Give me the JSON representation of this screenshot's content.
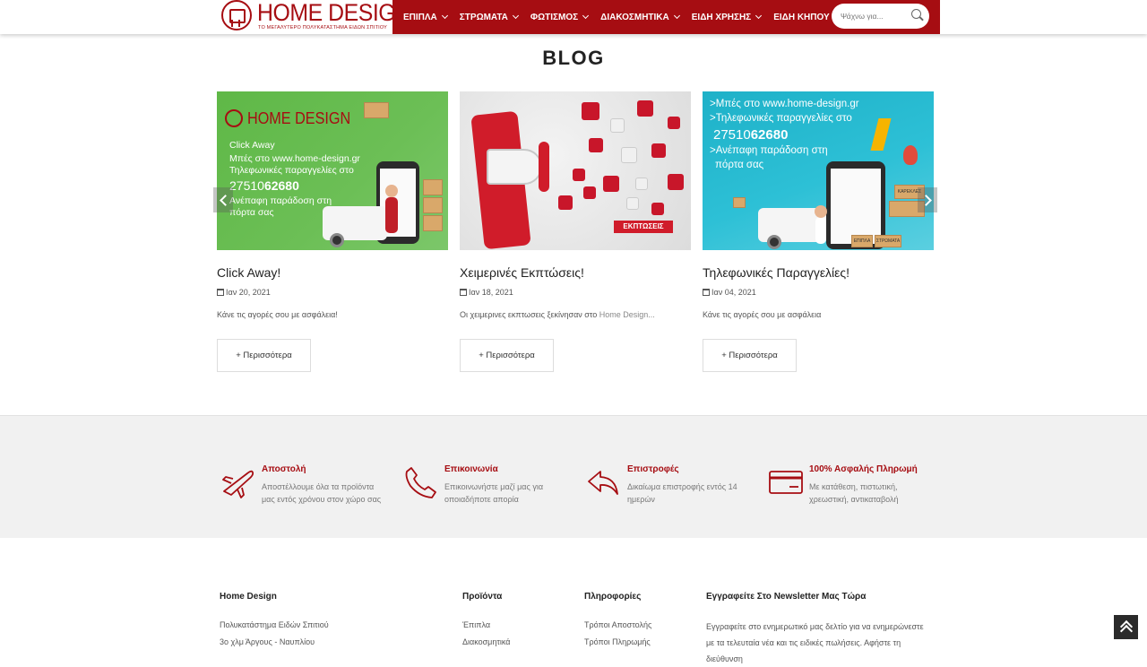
{
  "header": {
    "logo_text": "HOME DESIGN",
    "logo_tagline": "ΤΟ ΜΕΓΑΛΥΤΕΡΟ ΠΟΛΥΚΑΤΑΣΤΗΜΑ ΕΙΔΩΝ ΣΠΙΤΙΟΥ",
    "nav": [
      {
        "label": "ΕΠΙΠΛΑ"
      },
      {
        "label": "ΣΤΡΩΜΑΤΑ"
      },
      {
        "label": "ΦΩΤΙΣΜΟΣ"
      },
      {
        "label": "ΔΙΑΚΟΣΜΗΤΙΚΑ"
      },
      {
        "label": "ΕΙΔΗ ΧΡΗΣΗΣ"
      },
      {
        "label": "ΕΙΔΗ ΚΗΠΟΥ"
      }
    ],
    "search_placeholder": "Ψάχνω για...",
    "brand_color": "#a60d12"
  },
  "blog": {
    "title": "BLOG",
    "posts": [
      {
        "title": "Click Away!",
        "date": "Ιαν 20, 2021",
        "excerpt": "Κάνε τις αγορές σου με ασφάλεια!",
        "excerpt_highlight": "",
        "button": "+ Περισσότερα",
        "image": {
          "logo": "HOME DESIGN",
          "lines": [
            "Click Away",
            "Μπές στο www.home-design.gr",
            "Τηλεφωνικές παραγγελίες στο"
          ],
          "phone_prefix": "27510",
          "phone_bold": "62680",
          "lines2": [
            "Ανέπαφη παράδοση στη",
            "πόρτα σας"
          ]
        }
      },
      {
        "title": "Χειμερινές Εκπτώσεις!",
        "date": "Ιαν 18, 2021",
        "excerpt": "Οι χειμερινες εκπτωσεις ξεκίνησαν στο ",
        "excerpt_highlight": "Home Design...",
        "button": "+ Περισσότερα",
        "image": {
          "badge": "ΕΚΠΤΩΣΕΙΣ",
          "percent": "%"
        }
      },
      {
        "title": "Τηλεφωνικές Παραγγελίες!",
        "date": "Ιαν 04, 2021",
        "excerpt": "Κάνε τις αγορές σου με ασφάλεια",
        "excerpt_highlight": "",
        "button": "+ Περισσότερα",
        "image": {
          "lines": [
            ">Μπές στο www.home-design.gr",
            ">Τηλεφωνικές παραγγελίες στο"
          ],
          "phone_prefix": "27510",
          "phone_bold": "62680",
          "lines2": [
            ">Ανέπαφη παράδοση στη",
            "πόρτα σας"
          ],
          "box_labels": [
            "ΕΠΙΠΛΑ",
            "ΣΤΡΩΜΑΤΑ",
            "ΚΑΡΕΚΛΕΣ"
          ]
        }
      }
    ]
  },
  "features": [
    {
      "title": "Αποστολή",
      "text": "Αποστέλλουμε όλα τα προϊόντα μας εντός χρόνου στον χώρο σας",
      "icon": "airplane-icon"
    },
    {
      "title": "Επικοινωνία",
      "text": "Επικοινωνήστε μαζί μας για οποιαδήποτε απορία",
      "icon": "phone-icon"
    },
    {
      "title": "Επιστροφές",
      "text": "Δικαίωμα επιστροφής εντός 14 ημερών",
      "icon": "return-arrow-icon"
    },
    {
      "title": "100% Ασφαλής Πληρωμή",
      "text": "Με κατάθεση, πιστωτική, χρεωστική, αντικαταβολή",
      "icon": "credit-card-icon"
    }
  ],
  "footer": {
    "about": {
      "heading": "Home Design",
      "lines": [
        "Πολυκατάστημα Ειδών Σπιτιού",
        "3ο χλμ Άργους - Ναυπλίου"
      ]
    },
    "products": {
      "heading": "Προϊόντα",
      "links": [
        "Έπιπλα",
        "Διακοσμητικά"
      ]
    },
    "info": {
      "heading": "Πληροφορίες",
      "links": [
        "Τρόποι Αποστολής",
        "Τρόποι Πληρωμής"
      ]
    },
    "newsletter": {
      "heading": "Εγγραφείτε Στο Newsletter Μας Τώρα",
      "text": "Εγγραφείτε στο ενημερωτικό μας δελτίο για να ενημερώνεστε με τα τελευταία νέα και τις ειδικές πωλήσεις. Αφήστε τη διεύθυνση"
    }
  }
}
